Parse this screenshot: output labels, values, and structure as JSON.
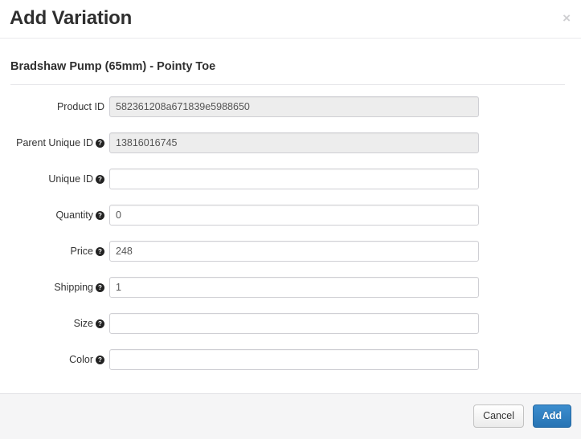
{
  "header": {
    "title": "Add Variation",
    "close_label": "×"
  },
  "body": {
    "product_name": "Bradshaw Pump (65mm) - Pointy Toe",
    "help_glyph": "?",
    "fields": [
      {
        "label": "Product ID",
        "value": "582361208a671839e5988650",
        "has_help": false,
        "readonly": true,
        "name": "product-id"
      },
      {
        "label": "Parent Unique ID",
        "value": "13816016745",
        "has_help": true,
        "readonly": true,
        "name": "parent-unique-id"
      },
      {
        "label": "Unique ID",
        "value": "",
        "has_help": true,
        "readonly": false,
        "name": "unique-id"
      },
      {
        "label": "Quantity",
        "value": "0",
        "has_help": true,
        "readonly": false,
        "name": "quantity"
      },
      {
        "label": "Price",
        "value": "248",
        "has_help": true,
        "readonly": false,
        "name": "price"
      },
      {
        "label": "Shipping",
        "value": "1",
        "has_help": true,
        "readonly": false,
        "name": "shipping"
      },
      {
        "label": "Size",
        "value": "",
        "has_help": true,
        "readonly": false,
        "name": "size"
      },
      {
        "label": "Color",
        "value": "",
        "has_help": true,
        "readonly": false,
        "name": "color"
      }
    ]
  },
  "footer": {
    "cancel_label": "Cancel",
    "add_label": "Add"
  },
  "colors": {
    "primary": "#2774b4",
    "readonly_field_bg": "#ededed",
    "footer_bg": "#f5f5f6",
    "border": "#cfcfd4"
  }
}
